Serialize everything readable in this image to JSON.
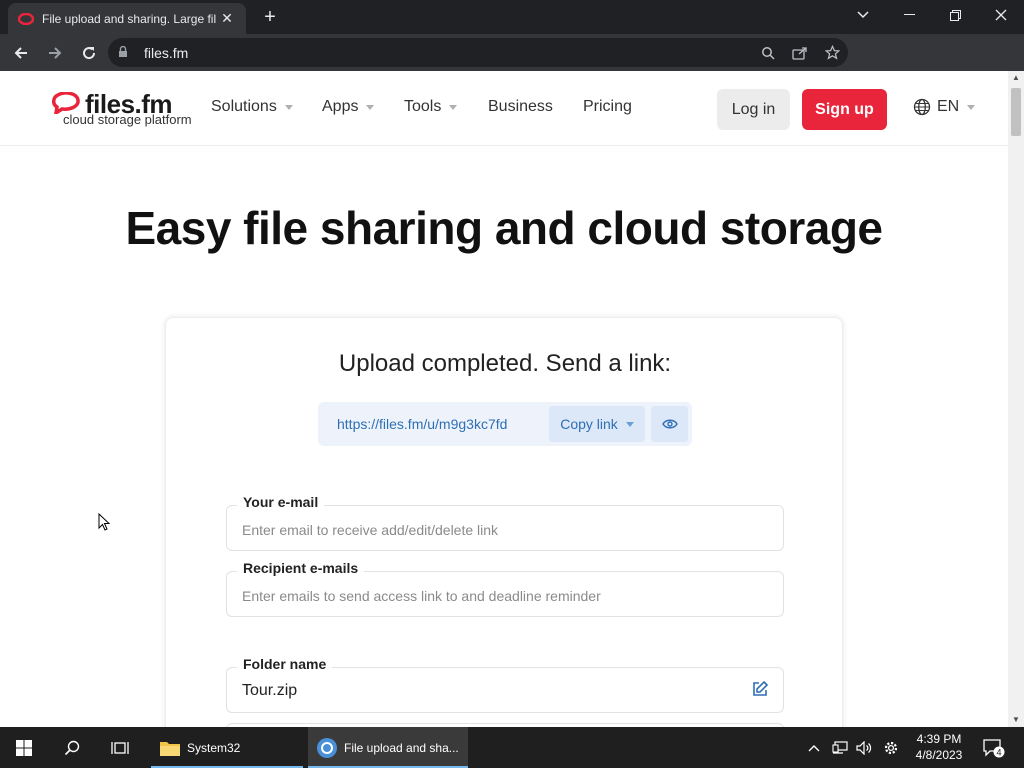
{
  "browser": {
    "tab_title": "File upload and sharing. Large fil",
    "new_tab": "+",
    "url": "files.fm"
  },
  "site": {
    "logo_name": "files.fm",
    "logo_tagline": "cloud storage platform",
    "nav": [
      {
        "label": "Solutions",
        "dropdown": true
      },
      {
        "label": "Apps",
        "dropdown": true
      },
      {
        "label": "Tools",
        "dropdown": true
      },
      {
        "label": "Business",
        "dropdown": false
      },
      {
        "label": "Pricing",
        "dropdown": false
      }
    ],
    "login": "Log in",
    "signup": "Sign up",
    "language": "EN"
  },
  "hero": {
    "title": "Easy file sharing and cloud storage"
  },
  "upload": {
    "title": "Upload completed. Send a link:",
    "link": "https://files.fm/u/m9g3kc7fd",
    "copy_label": "Copy link",
    "your_email_label": "Your e-mail",
    "your_email_placeholder": "Enter email to receive add/edit/delete link",
    "recipient_label": "Recipient e-mails",
    "recipient_placeholder": "Enter emails to send access link to and deadline reminder",
    "folder_label": "Folder name",
    "folder_value": "Tour.zip"
  },
  "taskbar": {
    "apps": [
      {
        "label": "System32",
        "active": false
      },
      {
        "label": "File upload and sha...",
        "active": true
      }
    ],
    "time": "4:39 PM",
    "date": "4/8/2023",
    "notifications": "4"
  },
  "colors": {
    "brand_red": "#e8253a",
    "link_blue": "#2e6fb5"
  }
}
